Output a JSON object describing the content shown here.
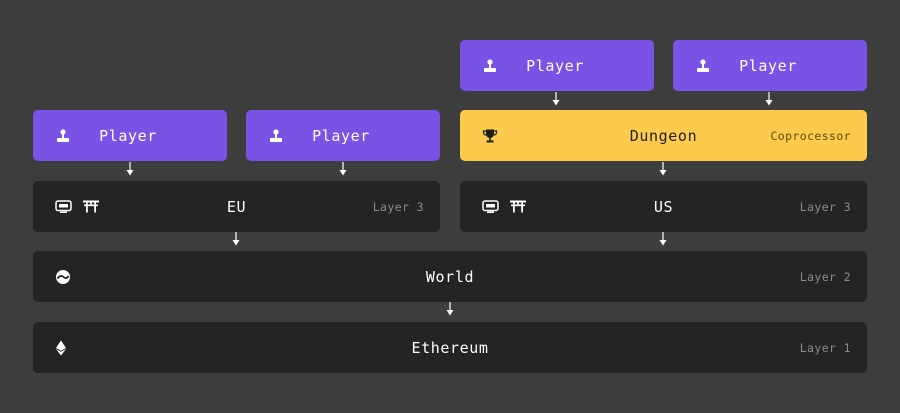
{
  "diagram": {
    "players": [
      {
        "label": "Player",
        "icon": "joystick-icon"
      },
      {
        "label": "Player",
        "icon": "joystick-icon"
      },
      {
        "label": "Player",
        "icon": "joystick-icon"
      },
      {
        "label": "Player",
        "icon": "joystick-icon"
      }
    ],
    "dungeon": {
      "label": "Dungeon",
      "tag": "Coprocessor",
      "icon": "trophy-icon"
    },
    "eu": {
      "label": "EU",
      "tag": "Layer 3",
      "icons": [
        "monitor-icon",
        "torii-gate-icon"
      ]
    },
    "us": {
      "label": "US",
      "tag": "Layer 3",
      "icons": [
        "monitor-icon",
        "torii-gate-icon"
      ]
    },
    "world": {
      "label": "World",
      "tag": "Layer 2",
      "icon": "world-logo-icon"
    },
    "ethereum": {
      "label": "Ethereum",
      "tag": "Layer 1",
      "icon": "ethereum-icon"
    }
  },
  "colors": {
    "background": "#3d3d3d",
    "player": "#7b52e6",
    "dungeon": "#fdcb4c",
    "layer_box": "#242424"
  }
}
